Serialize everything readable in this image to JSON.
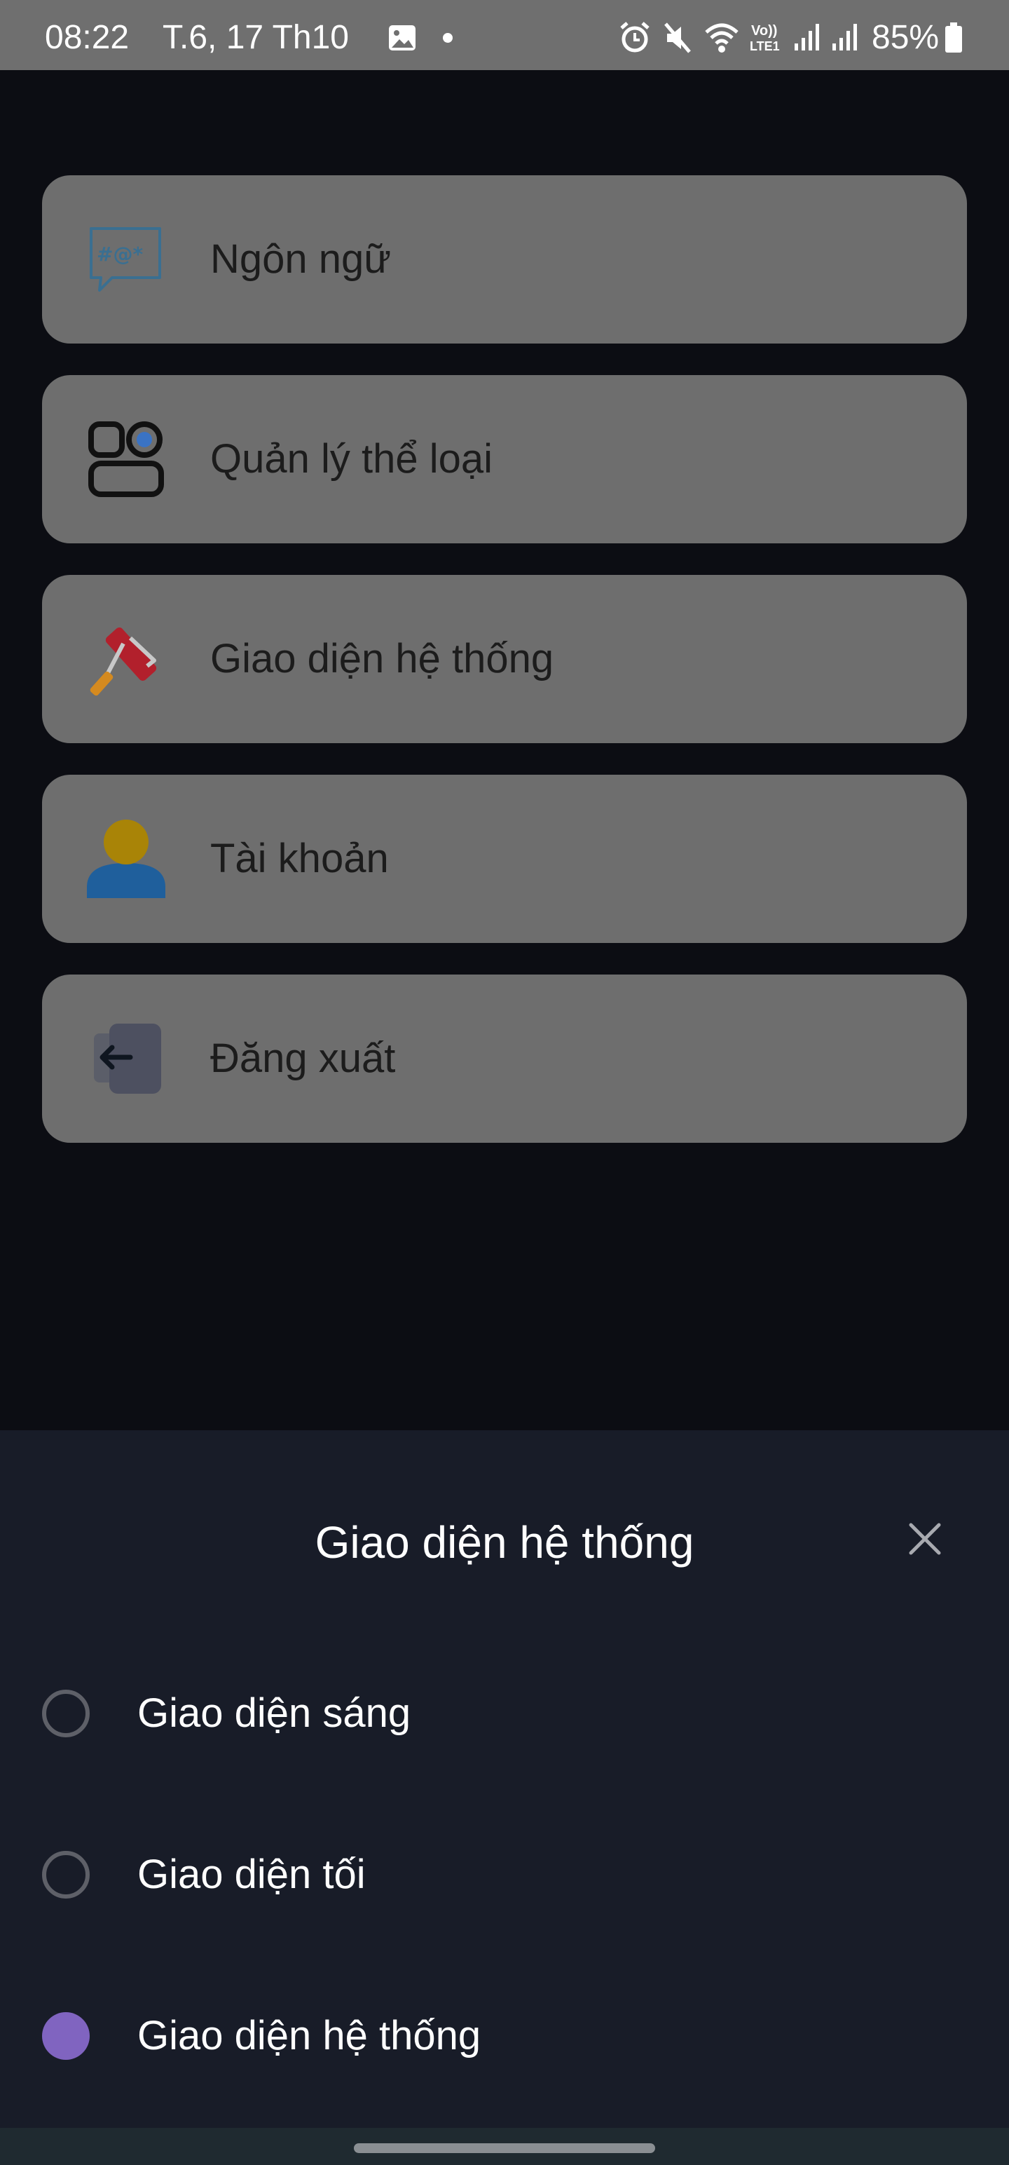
{
  "status_bar": {
    "time": "08:22",
    "date": "T.6, 17 Th10",
    "battery": "85%",
    "icons": [
      "gallery-icon",
      "dot-icon",
      "alarm-icon",
      "mute-icon",
      "wifi-icon",
      "volte-icon",
      "signal-icon",
      "signal-icon",
      "battery-icon"
    ]
  },
  "menu": {
    "items": [
      {
        "label": "Ngôn ngữ",
        "icon": "language-chat-icon"
      },
      {
        "label": "Quản lý thể loại",
        "icon": "category-toggle-icon"
      },
      {
        "label": "Giao diện hệ thống",
        "icon": "paint-roller-icon"
      },
      {
        "label": "Tài khoản",
        "icon": "user-icon"
      },
      {
        "label": "Đăng xuất",
        "icon": "logout-icon"
      }
    ]
  },
  "sheet": {
    "title": "Giao diện hệ thống",
    "close_icon": "close-icon",
    "options": [
      {
        "label": "Giao diện sáng",
        "selected": false
      },
      {
        "label": "Giao diện tối",
        "selected": false
      },
      {
        "label": "Giao diện hệ thống",
        "selected": true
      }
    ]
  },
  "colors": {
    "accent": "#8064c0",
    "sheet_bg": "#181c28",
    "card_bg": "#6e6e6e"
  }
}
